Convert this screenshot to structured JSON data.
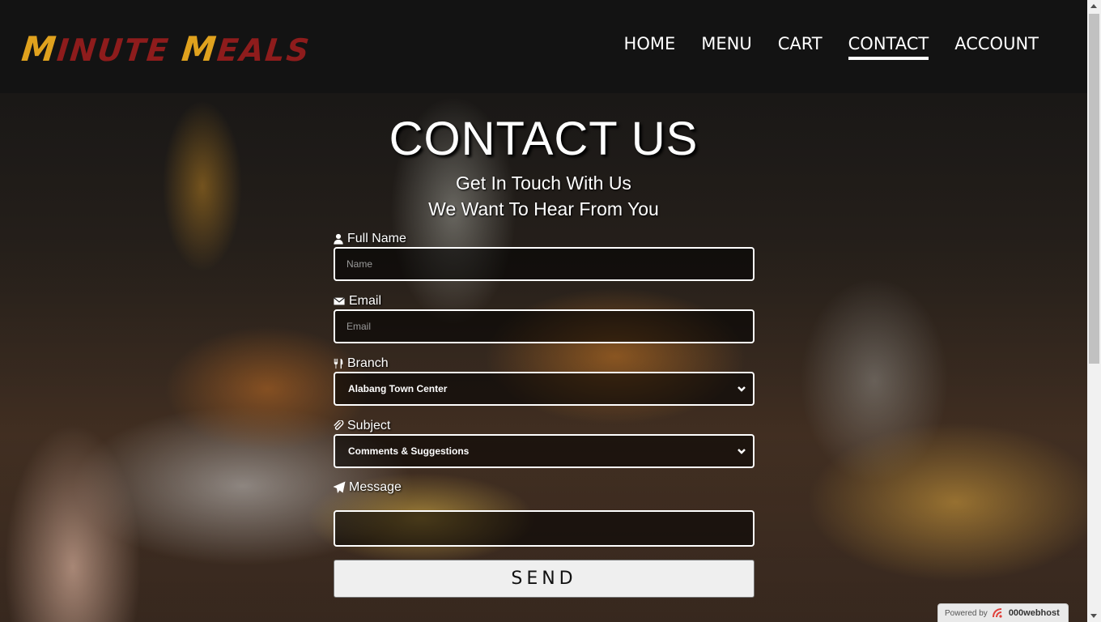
{
  "header": {
    "logo": {
      "word1_initial": "M",
      "word1_rest": "INUTE",
      "word2_initial": "M",
      "word2_rest": "EALS"
    },
    "nav": [
      {
        "label": "HOME"
      },
      {
        "label": "MENU"
      },
      {
        "label": "CART"
      },
      {
        "label": "CONTACT",
        "active": true
      },
      {
        "label": "ACCOUNT"
      }
    ]
  },
  "main": {
    "title": "CONTACT US",
    "subtitle_line1": "Get In Touch With Us",
    "subtitle_line2": "We Want To Hear From You"
  },
  "form": {
    "full_name": {
      "label": "Full Name",
      "placeholder": "Name",
      "icon": "user-icon"
    },
    "email": {
      "label": "Email",
      "placeholder": "Email",
      "icon": "envelope-icon"
    },
    "branch": {
      "label": "Branch",
      "selected": "Alabang Town Center",
      "icon": "cutlery-icon"
    },
    "subject": {
      "label": "Subject",
      "selected": "Comments & Suggestions",
      "icon": "paperclip-icon"
    },
    "message": {
      "label": "Message",
      "icon": "paper-plane-icon"
    },
    "send_label": "SEND"
  },
  "badge": {
    "powered_by": "Powered by",
    "host": "000webhost"
  },
  "colors": {
    "logo_red": "#8e1c1c",
    "logo_gold": "#e0a21e",
    "header_bg": "#131313"
  }
}
